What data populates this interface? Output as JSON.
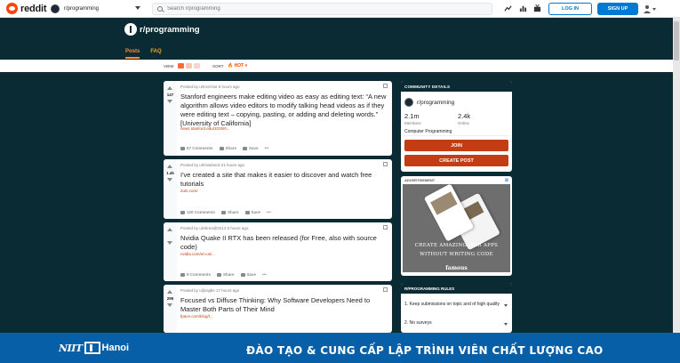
{
  "header": {
    "logo_text": "reddit",
    "community": "r/programming",
    "search_placeholder": "Search r/programming",
    "login_label": "LOG IN",
    "signup_label": "SIGN UP"
  },
  "subreddit": {
    "title": "r/programming",
    "tabs": [
      {
        "label": "Posts"
      },
      {
        "label": "FAQ"
      }
    ]
  },
  "viewbar": {
    "view_label": "VIEW",
    "sort_label": "SORT",
    "sort_value": "HOT"
  },
  "posts": [
    {
      "votes": "147",
      "meta": "Posted by u/trost-bot 6 hours ago",
      "title": "Stanford engineers make editing video as easy as editing text: “A new algorithm allows video editors to modify talking head videos as if they were editing text – copying, pasting, or adding and deleting words.” [University of California]",
      "link": "news.stanford.edu/2019/0...",
      "comments": "57 Comments",
      "share": "Share",
      "save": "Save",
      "more": "•••"
    },
    {
      "votes": "1.4k",
      "meta": "Posted by u/trivialnerd 21 hours ago",
      "title": "I've created a site that makes it easier to discover and watch free tutorials",
      "link": "2uts.com/",
      "comments": "120 Comments",
      "share": "Share",
      "save": "Save",
      "more": "•••"
    },
    {
      "votes": "",
      "meta": "Posted by u/Hilrea@0213 6 hours ago",
      "title": "Nvidia Quake II RTX has been released (for Free, also with source code)",
      "link": "nvidia.com/en-us/...",
      "comments": "9 Comments",
      "share": "Share",
      "save": "Save",
      "more": "•••"
    },
    {
      "votes": "295",
      "meta": "Posted by u/jlsajdie 17 hours ago",
      "title": "Focused vs Diffuse Thinking: Why Software Developers Need to Master Both Parts of Their Mind",
      "link": "fpace.com/blog/t...",
      "comments": "",
      "share": "",
      "save": "",
      "more": ""
    }
  ],
  "sidebar": {
    "community_details_header": "COMMUNITY DETAILS",
    "community_name": "r/programming",
    "members_value": "2.1m",
    "members_label": "Members",
    "online_value": "2.4k",
    "online_label": "Online",
    "topic": "Computer Programming",
    "join_label": "JOIN",
    "create_post_label": "CREATE POST",
    "ad_label": "ADVERTISEMENT",
    "ad_line1": "CREATE AMAZING WEB APPS",
    "ad_line2": "WITHOUT WRITING CODE",
    "ad_brand": "famous",
    "rules_header": "R/PROGRAMMING RULES",
    "rules": [
      {
        "text": "1. Keep submissions on topic and of high quality"
      },
      {
        "text": "2. No surveys"
      }
    ]
  },
  "footer": {
    "brand_left": "NIIT",
    "brand_right": "Hanoi",
    "slogan": "ĐÀO TẠO & CUNG CẤP LẬP TRÌNH VIÊN CHẤT LƯỢNG CAO"
  },
  "colors": {
    "reddit_orange": "#ff4500",
    "banner": "#0a2b34",
    "accent_blue": "#0079d3",
    "button_red": "#c43c14",
    "footer_blue": "#075fa8"
  }
}
